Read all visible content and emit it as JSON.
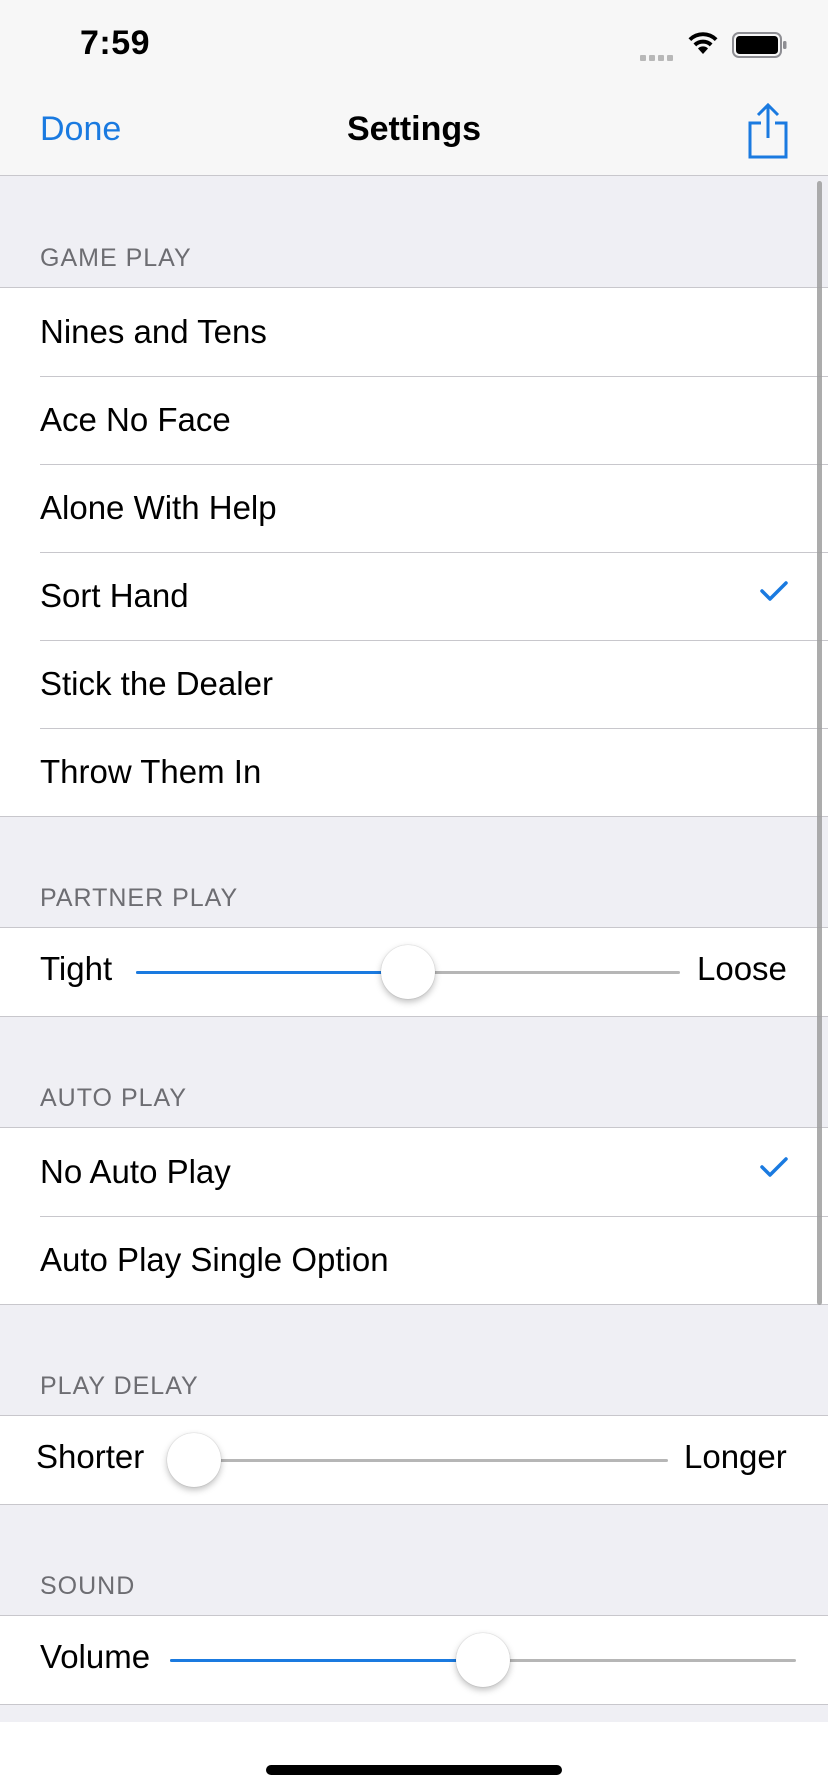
{
  "status_bar": {
    "time": "7:59"
  },
  "nav": {
    "done_label": "Done",
    "title": "Settings",
    "share_icon": "share-icon"
  },
  "colors": {
    "accent": "#1A7AE0",
    "background": "#EFEFF4",
    "separator": "#C8C7CC"
  },
  "sections": {
    "game_play": {
      "header": "GAME PLAY",
      "items": [
        {
          "label": "Nines and Tens",
          "checked": false
        },
        {
          "label": "Ace No Face",
          "checked": false
        },
        {
          "label": "Alone With Help",
          "checked": false
        },
        {
          "label": "Sort Hand",
          "checked": true
        },
        {
          "label": "Stick the Dealer",
          "checked": false
        },
        {
          "label": "Throw Them In",
          "checked": false
        }
      ]
    },
    "partner_play": {
      "header": "PARTNER PLAY",
      "min_label": "Tight",
      "max_label": "Loose",
      "value": 0.5
    },
    "auto_play": {
      "header": "AUTO PLAY",
      "items": [
        {
          "label": "No Auto Play",
          "checked": true
        },
        {
          "label": "Auto Play Single Option",
          "checked": false
        }
      ]
    },
    "play_delay": {
      "header": "PLAY DELAY",
      "min_label": "Shorter",
      "max_label": "Longer",
      "value": 0.0
    },
    "sound": {
      "header": "SOUND",
      "label": "Volume",
      "value": 0.5
    }
  }
}
